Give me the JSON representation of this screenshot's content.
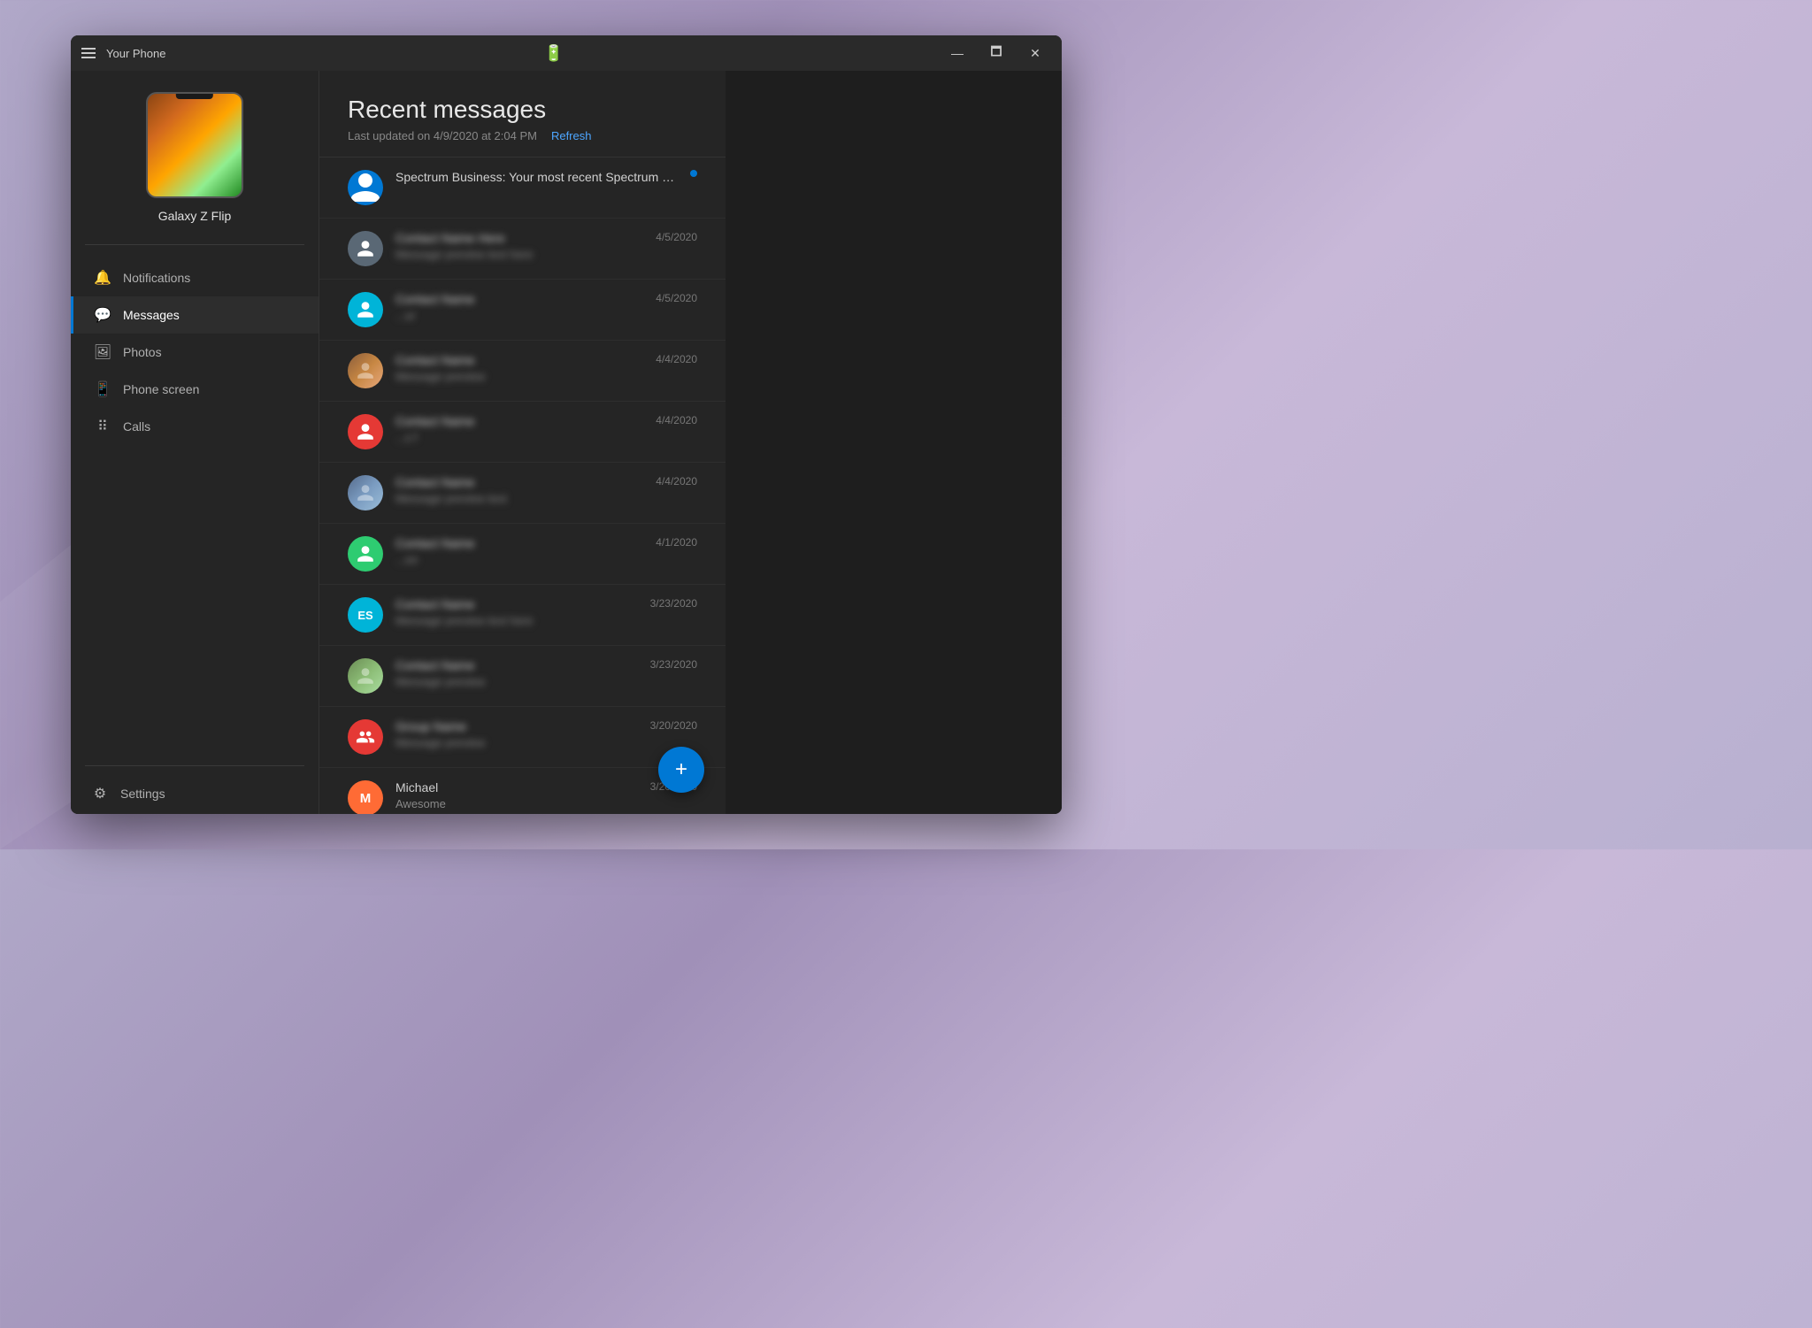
{
  "window": {
    "title": "Your Phone",
    "min_label": "—",
    "max_label": "🗖",
    "close_label": "✕"
  },
  "sidebar": {
    "device_name": "Galaxy Z Flip",
    "nav_items": [
      {
        "id": "notifications",
        "label": "Notifications",
        "icon": "bell"
      },
      {
        "id": "messages",
        "label": "Messages",
        "icon": "chat",
        "active": true
      },
      {
        "id": "photos",
        "label": "Photos",
        "icon": "photo"
      },
      {
        "id": "phone-screen",
        "label": "Phone screen",
        "icon": "phone"
      },
      {
        "id": "calls",
        "label": "Calls",
        "icon": "grid"
      }
    ],
    "settings_label": "Settings"
  },
  "messages": {
    "title": "Recent messages",
    "last_updated": "Last updated on 4/9/2020 at 2:04 PM",
    "refresh_label": "Refresh",
    "items": [
      {
        "id": 1,
        "sender": "Spectrum Business: Your most recent Spectrum Business bill is available online",
        "preview": "",
        "date": "",
        "unread": true,
        "avatar_type": "icon",
        "avatar_color": "blue",
        "initials": ""
      },
      {
        "id": 2,
        "sender": "",
        "preview": "",
        "date": "4/5/2020",
        "unread": false,
        "avatar_type": "icon",
        "avatar_color": "gray",
        "initials": "",
        "blurred": true
      },
      {
        "id": 3,
        "sender": "",
        "preview": "ur",
        "date": "4/5/2020",
        "unread": false,
        "avatar_type": "icon",
        "avatar_color": "teal",
        "initials": "",
        "blurred": true
      },
      {
        "id": 4,
        "sender": "",
        "preview": "",
        "date": "4/4/2020",
        "unread": false,
        "avatar_type": "photo",
        "avatar_color": "gray",
        "initials": "",
        "blurred": true
      },
      {
        "id": 5,
        "sender": "",
        "preview": "s f",
        "date": "4/4/2020",
        "unread": false,
        "avatar_type": "icon",
        "avatar_color": "red",
        "initials": "",
        "blurred": true
      },
      {
        "id": 6,
        "sender": "",
        "preview": "",
        "date": "4/4/2020",
        "unread": false,
        "avatar_type": "photo2",
        "avatar_color": "gray",
        "initials": "",
        "blurred": true
      },
      {
        "id": 7,
        "sender": "",
        "preview": "on",
        "date": "4/1/2020",
        "unread": false,
        "avatar_type": "icon",
        "avatar_color": "green",
        "initials": "",
        "blurred": true
      },
      {
        "id": 8,
        "sender": "",
        "preview": "",
        "date": "3/23/2020",
        "unread": false,
        "avatar_type": "initials",
        "avatar_color": "teal",
        "initials": "ES",
        "blurred": true
      },
      {
        "id": 9,
        "sender": "",
        "preview": "",
        "date": "3/23/2020",
        "unread": false,
        "avatar_type": "photo3",
        "avatar_color": "gray",
        "initials": "",
        "blurred": true
      },
      {
        "id": 10,
        "sender": "",
        "preview": "",
        "date": "3/20/2020",
        "unread": false,
        "avatar_type": "icon-group",
        "avatar_color": "red",
        "initials": "",
        "blurred": true
      },
      {
        "id": 11,
        "sender": "Michael",
        "preview": "Awesome",
        "date": "3/20/2020",
        "unread": false,
        "avatar_type": "initials",
        "avatar_color": "orange",
        "initials": "M",
        "blurred": false
      }
    ]
  }
}
